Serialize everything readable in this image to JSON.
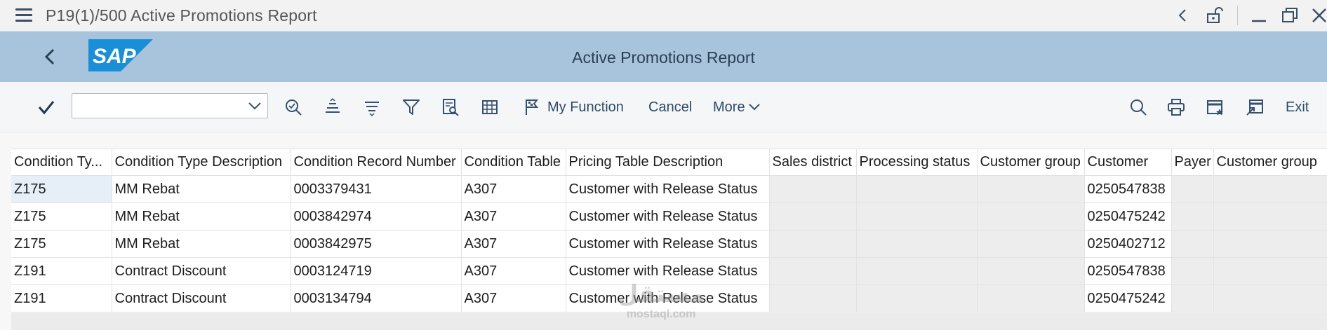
{
  "window": {
    "title": "P19(1)/500 Active Promotions Report"
  },
  "header": {
    "app_title": "Active Promotions Report",
    "logo_text": "SAP",
    "brand_color": "#1a8fd6"
  },
  "toolbar": {
    "combo_value": "",
    "my_function_label": "My Function",
    "cancel_label": "Cancel",
    "more_label": "More",
    "exit_label": "Exit"
  },
  "table": {
    "columns": [
      "Condition Ty...",
      "Condition Type Description",
      "Condition Record Number",
      "Condition Table",
      "Pricing Table Description",
      "Sales district",
      "Processing status",
      "Customer group",
      "Customer",
      "Payer",
      "Customer group"
    ],
    "rows": [
      [
        "Z175",
        "MM Rebat",
        "0003379431",
        "A307",
        "Customer with Release Status",
        "",
        "",
        "",
        "0250547838",
        "",
        ""
      ],
      [
        "Z175",
        "MM Rebat",
        "0003842974",
        "A307",
        "Customer with Release Status",
        "",
        "",
        "",
        "0250475242",
        "",
        ""
      ],
      [
        "Z175",
        "MM Rebat",
        "0003842975",
        "A307",
        "Customer with Release Status",
        "",
        "",
        "",
        "0250402712",
        "",
        ""
      ],
      [
        "Z191",
        "Contract Discount",
        "0003124719",
        "A307",
        "Customer with Release Status",
        "",
        "",
        "",
        "0250547838",
        "",
        ""
      ],
      [
        "Z191",
        "Contract Discount",
        "0003134794",
        "A307",
        "Customer with Release Status",
        "",
        "",
        "",
        "0250475242",
        "",
        ""
      ]
    ]
  },
  "watermark": {
    "arabic": "مستقل",
    "latin": "mostaql.com"
  }
}
